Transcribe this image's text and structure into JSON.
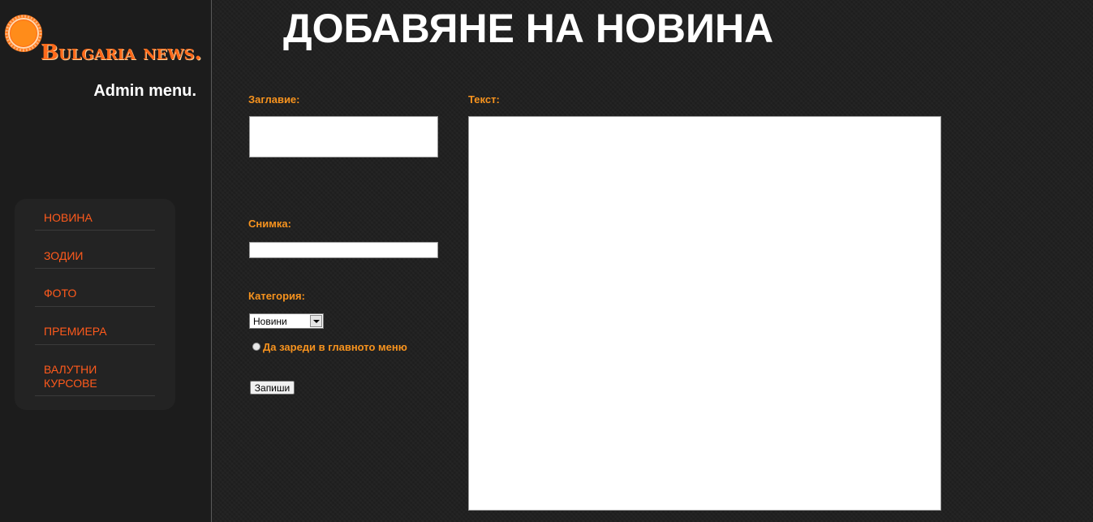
{
  "brand": {
    "name": "Bulgaria news."
  },
  "sidebar": {
    "admin_title": "Admin menu.",
    "items": [
      {
        "label": "НОВИНА"
      },
      {
        "label": "ЗОДИИ"
      },
      {
        "label": "ФОТО"
      },
      {
        "label": "ПРЕМИЕРА"
      },
      {
        "label": "ВАЛУТНИ КУРСОВЕ"
      }
    ]
  },
  "main": {
    "title": "ДОБАВЯНЕ НА НОВИНА",
    "form": {
      "title_label": "Заглавие:",
      "title_value": "",
      "image_label": "Снимка:",
      "image_value": "",
      "category_label": "Категория:",
      "category_selected": "Новини",
      "main_menu_option": "Да зареди в главното меню",
      "save_label": "Запиши",
      "text_label": "Текст:",
      "text_value": ""
    }
  },
  "colors": {
    "accent": "#f7931e",
    "menu_text": "#ff5a1c",
    "background": "#1f1f1f"
  },
  "icons": {
    "logo": "sun-logo-icon",
    "dropdown": "chevron-down-icon"
  }
}
